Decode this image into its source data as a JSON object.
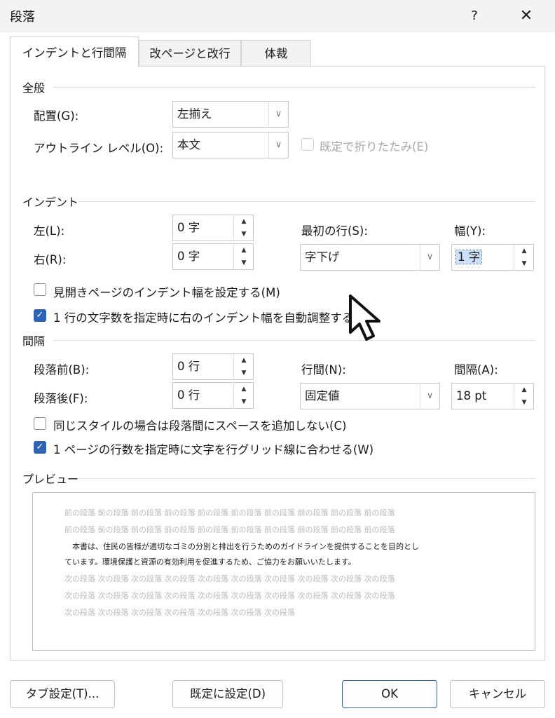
{
  "window": {
    "title": "段落",
    "help": "?",
    "close": "✕"
  },
  "tabs": [
    {
      "label": "インデントと行間隔"
    },
    {
      "label": "改ページと改行"
    },
    {
      "label": "体裁"
    }
  ],
  "general": {
    "title": "全般",
    "alignment_label": "配置(G):",
    "alignment_value": "左揃え",
    "outline_label": "アウトライン レベル(O):",
    "outline_value": "本文",
    "collapse_label": "既定で折りたたみ(E)"
  },
  "indent": {
    "title": "インデント",
    "left_label": "左(L):",
    "left_value": "0 字",
    "right_label": "右(R):",
    "right_value": "0 字",
    "first_line_label": "最初の行(S):",
    "first_line_value": "字下げ",
    "width_label": "幅(Y):",
    "width_value": "1 字",
    "mirror_label": "見開きページのインデント幅を設定する(M)",
    "mirror_checked": false,
    "auto_adjust_label": "1 行の文字数を指定時に右のインデント幅を自動調整する(D)",
    "auto_adjust_checked": true
  },
  "spacing": {
    "title": "間隔",
    "before_label": "段落前(B):",
    "before_value": "0 行",
    "after_label": "段落後(F):",
    "after_value": "0 行",
    "line_spacing_label": "行間(N):",
    "line_spacing_value": "固定値",
    "at_label": "間隔(A):",
    "at_value": "18 pt",
    "no_space_label": "同じスタイルの場合は段落間にスペースを追加しない(C)",
    "no_space_checked": false,
    "grid_label": "1 ページの行数を指定時に文字を行グリッド線に合わせる(W)",
    "grid_checked": true
  },
  "preview": {
    "title": "プレビュー",
    "prev_line1": "前の段落  前の段落  前の段落  前の段落  前の段落  前の段落  前の段落  前の段落  前の段落  前の段落",
    "prev_line2": "前の段落  前の段落  前の段落  前の段落  前の段落  前の段落  前の段落  前の段落  前の段落  前の段落",
    "body_line1": "　本書は、住民の皆様が適切なゴミの分別と排出を行うためのガイドラインを提供することを目的とし",
    "body_line2": "ています。環境保護と資源の有効利用を促進するため、ご協力をお願いいたします。",
    "next_line1": "次の段落  次の段落  次の段落  次の段落  次の段落  次の段落  次の段落  次の段落  次の段落  次の段落",
    "next_line2": "次の段落  次の段落  次の段落  次の段落  次の段落  次の段落  次の段落  次の段落  次の段落  次の段落",
    "next_line3": "次の段落  次の段落  次の段落  次の段落  次の段落  次の段落  次の段落"
  },
  "buttons": {
    "tabs": "タブ設定(T)...",
    "set_default": "既定に設定(D)",
    "ok": "OK",
    "cancel": "キャンセル"
  },
  "colors": {
    "accent": "#2b63b8",
    "selection": "#cde0f7"
  }
}
